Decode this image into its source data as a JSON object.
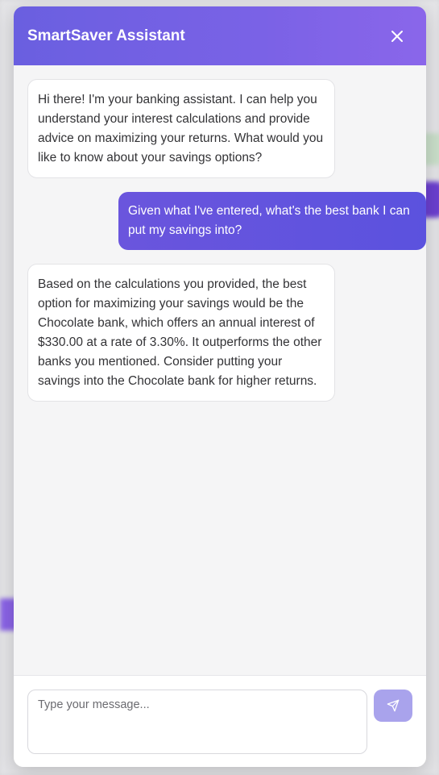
{
  "assistant": {
    "title": "SmartSaver Assistant",
    "close_icon": "close-icon"
  },
  "messages": [
    {
      "role": "assistant",
      "text": "Hi there! I'm your banking assistant. I can help you understand your interest calculations and provide advice on maximizing your returns. What would you like to know about your savings options?"
    },
    {
      "role": "user",
      "text": "Given what I've entered, what's the best bank I can put my savings into?"
    },
    {
      "role": "assistant",
      "text": "Based on the calculations you provided, the best option for maximizing your savings would be the Chocolate bank, which offers an annual interest of $330.00 at a rate of 3.30%. It outperforms the other banks you mentioned. Consider putting your savings into the Chocolate bank for higher returns."
    }
  ],
  "composer": {
    "placeholder": "Type your message...",
    "value": "",
    "send_icon": "send-icon"
  },
  "colors": {
    "header_gradient_start": "#6a5fe0",
    "header_gradient_end": "#8a66ea",
    "user_bubble": "#5b52de",
    "send_button": "#a9a3ec"
  }
}
